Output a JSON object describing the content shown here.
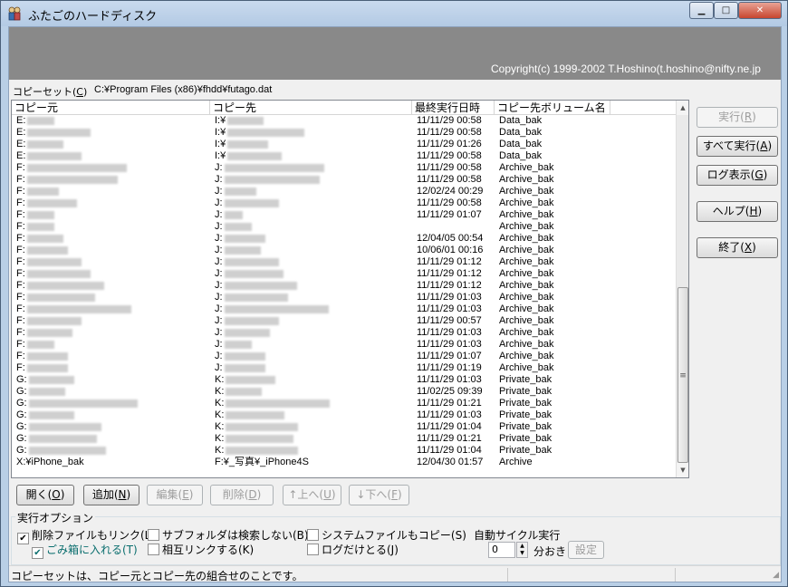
{
  "window": {
    "title": "ふたごのハードディスク",
    "min_glyph": "▁",
    "max_glyph": "□",
    "close_glyph": "✕"
  },
  "banner": {
    "copyright": "Copyright(c) 1999-2002 T.Hoshino(t.hoshino@nifty.ne.jp"
  },
  "copyset": {
    "label_prefix": "コピーセット(",
    "label_key": "C",
    "label_suffix": ")",
    "path": "C:¥Program Files (x86)¥fhdd¥futago.dat"
  },
  "columns": [
    "コピー元",
    "コピー先",
    "最終実行日時",
    "コピー先ボリューム名"
  ],
  "rows": [
    {
      "src": "E:",
      "dst": "I:¥",
      "date": "11/11/29 00:58",
      "vol": "Data_bak",
      "bs": 30,
      "bd": 40
    },
    {
      "src": "E:",
      "dst": "I:¥",
      "date": "11/11/29 00:58",
      "vol": "Data_bak",
      "bs": 70,
      "bd": 85
    },
    {
      "src": "E:",
      "dst": "I:¥",
      "date": "11/11/29 01:26",
      "vol": "Data_bak",
      "bs": 40,
      "bd": 45
    },
    {
      "src": "E:",
      "dst": "I:¥",
      "date": "11/11/29 00:58",
      "vol": "Data_bak",
      "bs": 60,
      "bd": 60
    },
    {
      "src": "F:",
      "dst": "J:",
      "date": "11/11/29 00:58",
      "vol": "Archive_bak",
      "bs": 110,
      "bd": 110
    },
    {
      "src": "F:",
      "dst": "J:",
      "date": "11/11/29 00:58",
      "vol": "Archive_bak",
      "bs": 100,
      "bd": 105
    },
    {
      "src": "F:",
      "dst": "J:",
      "date": "12/02/24 00:29",
      "vol": "Archive_bak",
      "bs": 35,
      "bd": 35
    },
    {
      "src": "F:",
      "dst": "J:",
      "date": "11/11/29 00:58",
      "vol": "Archive_bak",
      "bs": 55,
      "bd": 60
    },
    {
      "src": "F:",
      "dst": "J:",
      "date": "11/11/29 01:07",
      "vol": "Archive_bak",
      "bs": 30,
      "bd": 20
    },
    {
      "src": "F:",
      "dst": "J:",
      "date": "",
      "vol": "Archive_bak",
      "bs": 30,
      "bd": 30
    },
    {
      "src": "F:",
      "dst": "J:",
      "date": "12/04/05 00:54",
      "vol": "Archive_bak",
      "bs": 40,
      "bd": 45
    },
    {
      "src": "F:",
      "dst": "J:",
      "date": "10/06/01 00:16",
      "vol": "Archive_bak",
      "bs": 45,
      "bd": 40
    },
    {
      "src": "F:",
      "dst": "J:",
      "date": "11/11/29 01:12",
      "vol": "Archive_bak",
      "bs": 60,
      "bd": 60
    },
    {
      "src": "F:",
      "dst": "J:",
      "date": "11/11/29 01:12",
      "vol": "Archive_bak",
      "bs": 70,
      "bd": 65
    },
    {
      "src": "F:",
      "dst": "J:",
      "date": "11/11/29 01:12",
      "vol": "Archive_bak",
      "bs": 85,
      "bd": 80
    },
    {
      "src": "F:",
      "dst": "J:",
      "date": "11/11/29 01:03",
      "vol": "Archive_bak",
      "bs": 75,
      "bd": 70
    },
    {
      "src": "F:",
      "dst": "J:",
      "date": "11/11/29 01:03",
      "vol": "Archive_bak",
      "bs": 115,
      "bd": 115
    },
    {
      "src": "F:",
      "dst": "J:",
      "date": "11/11/29 00:57",
      "vol": "Archive_bak",
      "bs": 60,
      "bd": 60
    },
    {
      "src": "F:",
      "dst": "J:",
      "date": "11/11/29 01:03",
      "vol": "Archive_bak",
      "bs": 50,
      "bd": 50
    },
    {
      "src": "F:",
      "dst": "J:",
      "date": "11/11/29 01:03",
      "vol": "Archive_bak",
      "bs": 30,
      "bd": 30
    },
    {
      "src": "F:",
      "dst": "J:",
      "date": "11/11/29 01:07",
      "vol": "Archive_bak",
      "bs": 45,
      "bd": 45
    },
    {
      "src": "F:",
      "dst": "J:",
      "date": "11/11/29 01:19",
      "vol": "Archive_bak",
      "bs": 45,
      "bd": 45
    },
    {
      "src": "G:",
      "dst": "K:",
      "date": "11/11/29 01:03",
      "vol": "Private_bak",
      "bs": 50,
      "bd": 55
    },
    {
      "src": "G:",
      "dst": "K:",
      "date": "11/02/25 09:39",
      "vol": "Private_bak",
      "bs": 40,
      "bd": 40
    },
    {
      "src": "G:",
      "dst": "K:",
      "date": "11/11/29 01:21",
      "vol": "Private_bak",
      "bs": 120,
      "bd": 115
    },
    {
      "src": "G:",
      "dst": "K:",
      "date": "11/11/29 01:03",
      "vol": "Private_bak",
      "bs": 50,
      "bd": 65
    },
    {
      "src": "G:",
      "dst": "K:",
      "date": "11/11/29 01:04",
      "vol": "Private_bak",
      "bs": 80,
      "bd": 80
    },
    {
      "src": "G:",
      "dst": "K:",
      "date": "11/11/29 01:21",
      "vol": "Private_bak",
      "bs": 75,
      "bd": 75
    },
    {
      "src": "G:",
      "dst": "K:",
      "date": "11/11/29 01:04",
      "vol": "Private_bak",
      "bs": 85,
      "bd": 80
    },
    {
      "src": "X:¥iPhone_bak",
      "dst": "F:¥_写真¥_iPhone4S",
      "date": "12/04/30 01:57",
      "vol": "Archive",
      "bs": 0,
      "bd": 0
    }
  ],
  "side_buttons": [
    {
      "pre": "実行(",
      "key": "R",
      "post": ")",
      "disabled": true
    },
    {
      "pre": "すべて実行(",
      "key": "A",
      "post": ")",
      "disabled": false
    },
    {
      "pre": "ログ表示(",
      "key": "G",
      "post": ")",
      "disabled": false
    },
    {
      "pre": "ヘルプ(",
      "key": "H",
      "post": ")",
      "disabled": false
    },
    {
      "pre": "終了(",
      "key": "X",
      "post": ")",
      "disabled": false
    }
  ],
  "bottom_buttons": [
    {
      "pre": "開く(",
      "key": "O",
      "post": ")",
      "disabled": false
    },
    {
      "pre": "追加(",
      "key": "N",
      "post": ")",
      "disabled": false
    },
    {
      "pre": "編集(",
      "key": "E",
      "post": ")",
      "disabled": true
    },
    {
      "pre": "削除(",
      "key": "D",
      "post": ")",
      "disabled": true
    },
    {
      "pre": "↑上へ(",
      "key": "U",
      "post": ")",
      "disabled": true
    },
    {
      "pre": "↓下へ(",
      "key": "F",
      "post": ")",
      "disabled": true
    }
  ],
  "options": {
    "title": "実行オプション",
    "checks": [
      {
        "text": "削除ファイルもリンク(L)",
        "checked": true
      },
      {
        "text": "ごみ箱に入れる(T)",
        "checked": true
      },
      {
        "text": "サブフォルダは検索しない(B)",
        "checked": false
      },
      {
        "text": "相互リンクする(K)",
        "checked": false
      },
      {
        "text": "システムファイルもコピー(S)",
        "checked": false
      },
      {
        "text": "ログだけとる(J)",
        "checked": false
      }
    ],
    "auto_label": "自動サイクル実行",
    "interval_value": "0",
    "interval_unit": "分おき",
    "set_button": "設定"
  },
  "status": {
    "text": "コピーセットは、コピー元とコピー先の組合せのことです。"
  },
  "colors": {
    "banner": "#898989",
    "titlebar": "#b9cfe6",
    "close": "#c7452f"
  }
}
